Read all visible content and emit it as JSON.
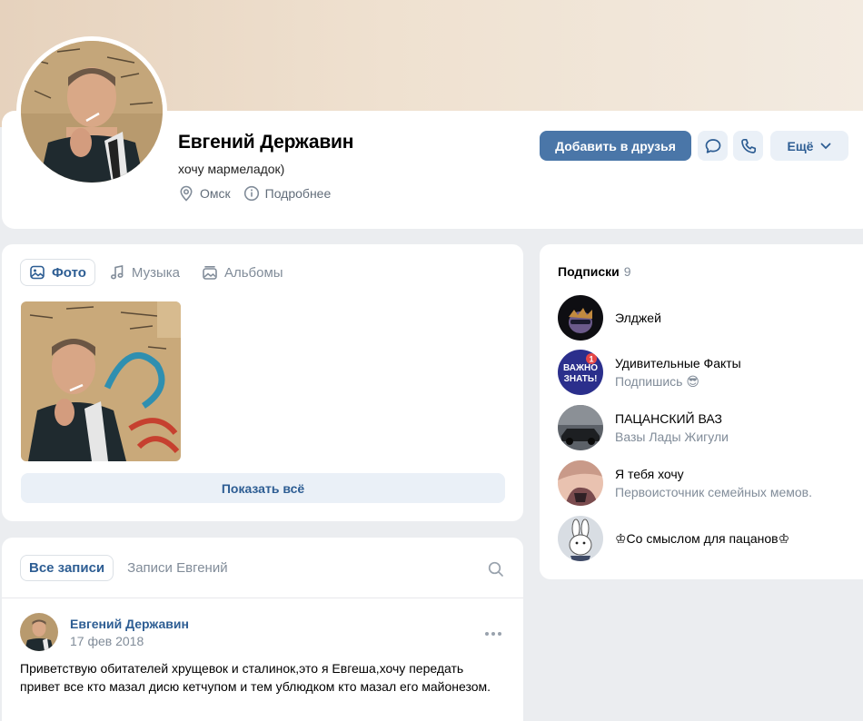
{
  "profile": {
    "name": "Евгений Державин",
    "status": "хочу мармеладок)",
    "city": "Омск",
    "more_info": "Подробнее"
  },
  "actions": {
    "add_friend": "Добавить в друзья",
    "more": "Ещё",
    "message_icon": "chat-bubble-icon",
    "call_icon": "phone-icon"
  },
  "media_tabs": [
    {
      "label": "Фото",
      "icon": "image-icon"
    },
    {
      "label": "Музыка",
      "icon": "music-note-icon"
    },
    {
      "label": "Альбомы",
      "icon": "albums-icon"
    }
  ],
  "photos": {
    "show_all": "Показать всё"
  },
  "subscriptions": {
    "title": "Подписки",
    "count": "9",
    "items": [
      {
        "name": "Элджей",
        "desc": ""
      },
      {
        "name": "Удивительные Факты",
        "desc": "Подпишись 😎",
        "badge": "1",
        "avatar_text_1": "ВАЖНО",
        "avatar_text_2": "ЗНАТЬ!"
      },
      {
        "name": "ПАЦАНСКИЙ ВАЗ",
        "desc": "Вазы Лады Жигули"
      },
      {
        "name": "Я тебя хочу",
        "desc": "Первоисточник семейных мемов."
      },
      {
        "name": "♔Со смыслом для пацанов♔",
        "desc": ""
      }
    ]
  },
  "wall": {
    "tabs": [
      "Все записи",
      "Записи Евгений"
    ],
    "post": {
      "author": "Евгений Державин",
      "date": "17 фев 2018",
      "text": "Приветствую обитателей хрущевок и сталинок,это я Евгеша,хочу передать привет все кто мазал дисю кетчупом и тем ублюдком кто мазал его майонезом."
    }
  },
  "colors": {
    "accent": "#4a76a8",
    "link": "#2d5d93",
    "secondary_text": "#818c99",
    "button_bg": "#eaf0f7",
    "page_bg": "#ebedf0"
  }
}
